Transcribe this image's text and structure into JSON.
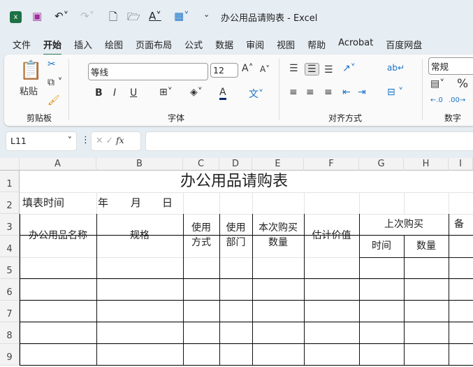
{
  "window": {
    "title": "办公用品请购表  -  Excel"
  },
  "ribbon_tabs": [
    "文件",
    "开始",
    "插入",
    "绘图",
    "页面布局",
    "公式",
    "数据",
    "审阅",
    "视图",
    "帮助",
    "Acrobat",
    "百度网盘"
  ],
  "active_tab": "开始",
  "ribbon": {
    "paste": "粘贴",
    "clipboard": "剪贴板",
    "font_name": "等线",
    "font_size": "12",
    "font_group": "字体",
    "align_group": "对齐方式",
    "number_format": "常规",
    "number_group": "数字",
    "bold": "B",
    "italic": "I",
    "underline": "U",
    "percent": "%"
  },
  "formula_bar": {
    "name_box": "L11",
    "fx": "fx",
    "formula": ""
  },
  "columns": [
    "A",
    "B",
    "C",
    "D",
    "E",
    "F",
    "G",
    "H",
    "I"
  ],
  "rows": [
    "1",
    "2",
    "3",
    "4",
    "5",
    "6",
    "7",
    "8",
    "9"
  ],
  "sheet": {
    "title": "办公用品请购表",
    "fill_time": "填表时间",
    "year": "年",
    "month": "月",
    "day": "日",
    "h_name": "办公用品名称",
    "h_spec": "规格",
    "h_method": "使用\n方式",
    "h_dept": "使用\n部门",
    "h_qty": "本次购买\n数量",
    "h_price": "估计价值",
    "h_last": "上次购买",
    "h_time": "时间",
    "h_lqty": "数量",
    "h_note": "备"
  },
  "colors": {
    "accent": "#1e7145"
  }
}
